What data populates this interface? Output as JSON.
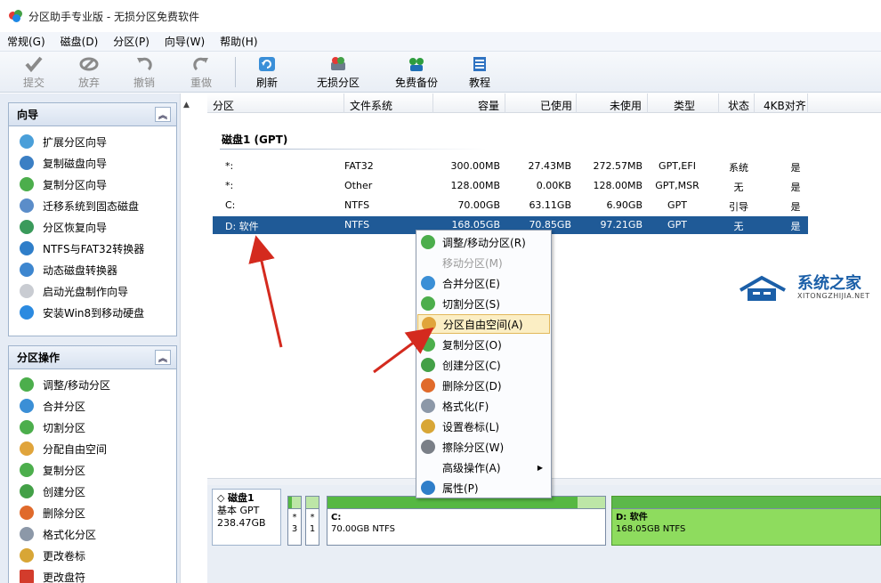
{
  "window": {
    "title": "分区助手专业版 - 无损分区免费软件"
  },
  "menu": [
    "常规(G)",
    "磁盘(D)",
    "分区(P)",
    "向导(W)",
    "帮助(H)"
  ],
  "toolbar": {
    "commit": "提交",
    "discard": "放弃",
    "undo": "撤销",
    "redo": "重做",
    "refresh": "刷新",
    "lossless": "无损分区",
    "backup": "免费备份",
    "tutorial": "教程"
  },
  "wizard_panel": {
    "title": "向导",
    "items": [
      "扩展分区向导",
      "复制磁盘向导",
      "复制分区向导",
      "迁移系统到固态磁盘",
      "分区恢复向导",
      "NTFS与FAT32转换器",
      "动态磁盘转换器",
      "启动光盘制作向导",
      "安装Win8到移动硬盘"
    ]
  },
  "partition_panel": {
    "title": "分区操作",
    "items": [
      "调整/移动分区",
      "合并分区",
      "切割分区",
      "分配自由空间",
      "复制分区",
      "创建分区",
      "删除分区",
      "格式化分区",
      "更改卷标",
      "更改盘符"
    ]
  },
  "table": {
    "headers": [
      "分区",
      "文件系统",
      "容量",
      "已使用",
      "未使用",
      "类型",
      "状态",
      "4KB对齐"
    ],
    "disk_label": "磁盘1 (GPT)",
    "rows": [
      [
        "*:",
        "FAT32",
        "300.00MB",
        "27.43MB",
        "272.57MB",
        "GPT,EFI",
        "系统",
        "是"
      ],
      [
        "*:",
        "Other",
        "128.00MB",
        "0.00KB",
        "128.00MB",
        "GPT,MSR",
        "无",
        "是"
      ],
      [
        "C:",
        "NTFS",
        "70.00GB",
        "63.11GB",
        "6.90GB",
        "GPT",
        "引导",
        "是"
      ],
      [
        "D: 软件",
        "NTFS",
        "168.05GB",
        "70.85GB",
        "97.21GB",
        "GPT",
        "无",
        "是"
      ]
    ],
    "selected_row": 3
  },
  "context_menu": {
    "items": [
      "调整/移动分区(R)",
      "移动分区(M)",
      "合并分区(E)",
      "切割分区(S)",
      "分区自由空间(A)",
      "复制分区(O)",
      "创建分区(C)",
      "删除分区(D)",
      "格式化(F)",
      "设置卷标(L)",
      "擦除分区(W)",
      "高级操作(A)",
      "属性(P)"
    ],
    "disabled_index": 1,
    "highlighted_index": 4,
    "submenu_index": 11
  },
  "disk_map": {
    "disk_name": "磁盘1",
    "disk_type": "基本 GPT",
    "disk_size": "238.47GB",
    "small_parts": [
      {
        "star": "*",
        "num": "3"
      },
      {
        "star": "*",
        "num": "1"
      }
    ],
    "c_label": "C:",
    "c_detail": "70.00GB NTFS",
    "c_used_fraction": 0.9,
    "d_label": "D: 软件",
    "d_detail": "168.05GB NTFS"
  },
  "watermark": {
    "name": "系统之家",
    "url": "XITONGZHIJIA.NET"
  },
  "colors": {
    "selection": "#1f5a97",
    "partition_used": "#56b843",
    "partition_free": "#8edc5e",
    "arrow": "#d42a1e"
  }
}
